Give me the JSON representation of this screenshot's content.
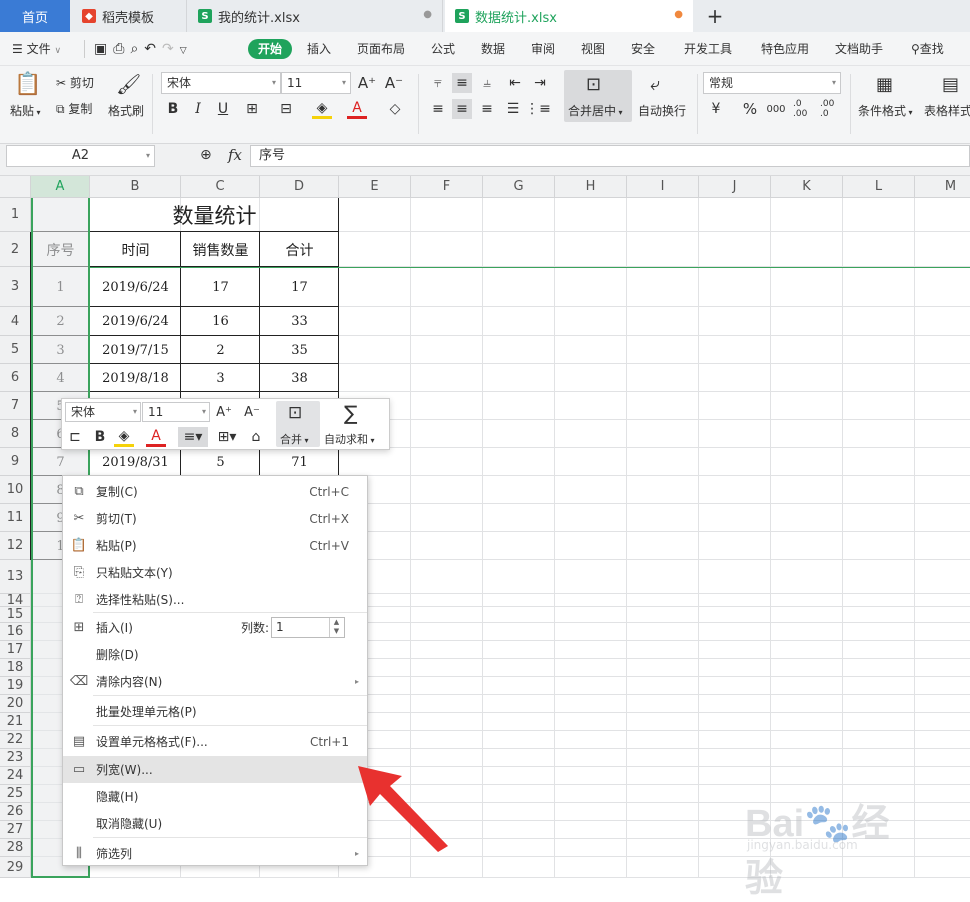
{
  "tabs": [
    {
      "label": "首页",
      "active": false
    },
    {
      "label": "稻壳模板",
      "icon": "daoke-icon",
      "color": "#e5432d"
    },
    {
      "label": "我的统计.xlsx",
      "icon": "sheet-icon",
      "color": "#1fa35c"
    },
    {
      "label": "数据统计.xlsx",
      "icon": "sheet-icon",
      "color": "#1fa35c",
      "active": true
    }
  ],
  "new_tab": "+",
  "menu": {
    "file": "文件",
    "items": [
      "开始",
      "插入",
      "页面布局",
      "公式",
      "数据",
      "审阅",
      "视图",
      "安全",
      "开发工具",
      "特色应用",
      "文档助手"
    ],
    "active": "开始",
    "search": "查找"
  },
  "ribbon": {
    "paste": "粘贴",
    "cut": "剪切",
    "copy": "复制",
    "format_painter": "格式刷",
    "font": "宋体",
    "size": "11",
    "bold": "B",
    "italic": "I",
    "underline": "U",
    "merge": "合并居中",
    "wrap": "自动换行",
    "number_format": "常规",
    "percent": "%",
    "thousands": "000",
    "dec_inc": ".0 .00",
    "dec_dec": ".00 .0",
    "cond_format": "条件格式",
    "table_style": "表格样式"
  },
  "formula_bar": {
    "name_box": "A2",
    "fx": "fx",
    "value": "序号"
  },
  "columns": [
    "A",
    "B",
    "C",
    "D",
    "E",
    "F",
    "G",
    "H",
    "I",
    "J",
    "K",
    "L",
    "M"
  ],
  "rows": [
    "1",
    "2",
    "3",
    "4",
    "5",
    "6",
    "7",
    "8",
    "9",
    "10",
    "11",
    "12",
    "13",
    "14",
    "15",
    "16",
    "17",
    "18",
    "19",
    "20",
    "21",
    "22",
    "23",
    "24",
    "25",
    "26",
    "27",
    "28",
    "29"
  ],
  "sheet": {
    "title": "数量统计",
    "headers": [
      "序号",
      "时间",
      "销售数量",
      "合计"
    ],
    "data": [
      [
        "1",
        "2019/6/24",
        "17",
        "17"
      ],
      [
        "2",
        "2019/6/24",
        "16",
        "33"
      ],
      [
        "3",
        "2019/7/15",
        "2",
        "35"
      ],
      [
        "4",
        "2019/8/18",
        "3",
        "38"
      ],
      [
        "5",
        "",
        "",
        ""
      ],
      [
        "6",
        "",
        "",
        ""
      ],
      [
        "7",
        "2019/8/31",
        "5",
        "71"
      ],
      [
        "8",
        "",
        "",
        ""
      ],
      [
        "9",
        "",
        "",
        ""
      ],
      [
        "1",
        "",
        "",
        ""
      ]
    ]
  },
  "mini_toolbar": {
    "font": "宋体",
    "size": "11",
    "merge": "合并",
    "autosum": "自动求和",
    "bold": "B"
  },
  "context_menu": [
    {
      "label": "复制(C)",
      "shortcut": "Ctrl+C",
      "icon": "copy-icon"
    },
    {
      "label": "剪切(T)",
      "shortcut": "Ctrl+X",
      "icon": "scissors-icon"
    },
    {
      "label": "粘贴(P)",
      "shortcut": "Ctrl+V",
      "icon": "paste-icon"
    },
    {
      "label": "只粘贴文本(Y)",
      "shortcut": "",
      "icon": "paste-text-icon"
    },
    {
      "label": "选择性粘贴(S)...",
      "shortcut": "",
      "icon": "paste-special-icon"
    },
    {
      "label": "插入(I)",
      "shortcut": "",
      "icon": "insert-icon",
      "extra_label": "列数:",
      "extra_value": "1"
    },
    {
      "label": "删除(D)",
      "shortcut": "",
      "icon": ""
    },
    {
      "label": "清除内容(N)",
      "shortcut": "",
      "icon": "eraser-icon",
      "submenu": true
    },
    {
      "label": "批量处理单元格(P)",
      "shortcut": "",
      "icon": ""
    },
    {
      "label": "设置单元格格式(F)...",
      "shortcut": "Ctrl+1",
      "icon": "format-cells-icon"
    },
    {
      "label": "列宽(W)...",
      "shortcut": "",
      "icon": "column-width-icon",
      "highlighted": true
    },
    {
      "label": "隐藏(H)",
      "shortcut": "",
      "icon": ""
    },
    {
      "label": "取消隐藏(U)",
      "shortcut": "",
      "icon": ""
    },
    {
      "label": "筛选列",
      "shortcut": "",
      "icon": "filter-column-icon",
      "submenu": true
    }
  ],
  "watermark": {
    "brand": "Bai",
    "brand2": "经验",
    "sub": "jingyan.baidu.com"
  },
  "colors": {
    "accent": "#1fa35c",
    "selection": "#3aa35c",
    "arrow": "#e8312f",
    "header_bg": "#f0f1f2",
    "home_tab": "#3a7bd5"
  }
}
